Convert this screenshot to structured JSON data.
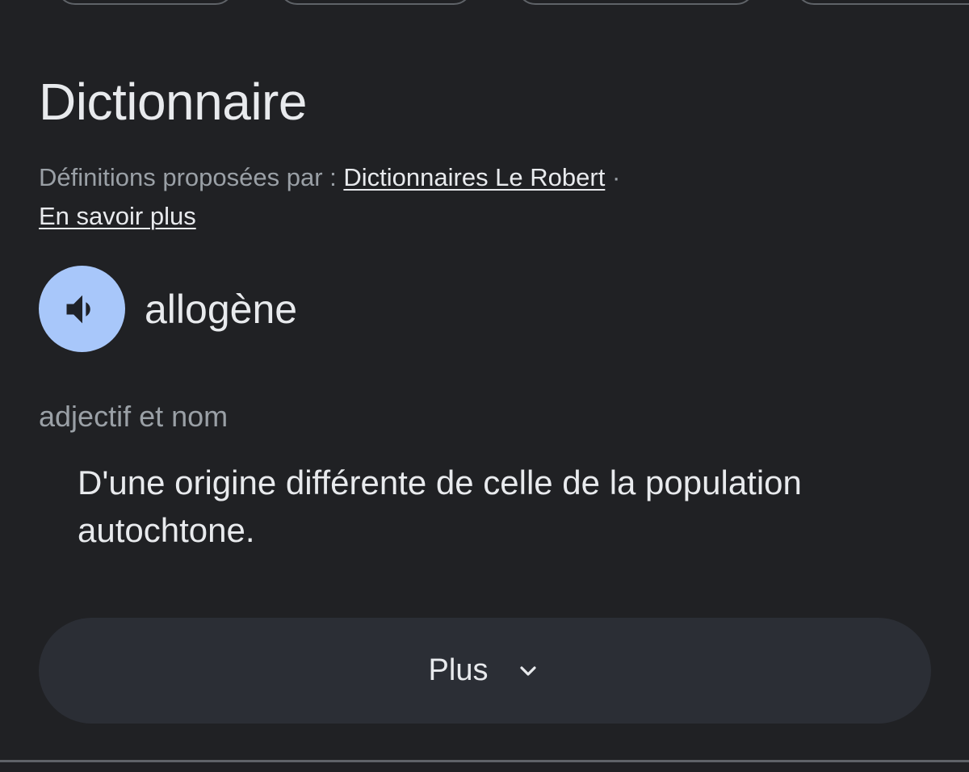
{
  "section": {
    "title": "Dictionnaire",
    "source_prefix": "Définitions proposées par : ",
    "source_link": "Dictionnaires Le Robert",
    "separator": " ·",
    "learn_more": "En savoir plus"
  },
  "entry": {
    "audio_icon": "volume-up-icon",
    "headword": "allogène",
    "part_of_speech": "adjectif et nom",
    "definition": "D'une origine différente de celle de la population autochtone."
  },
  "more_button": {
    "label": "Plus",
    "icon": "chevron-down-icon"
  },
  "colors": {
    "background": "#202124",
    "audio_button": "#a8c7fa",
    "more_button_bg": "#2b2e35",
    "muted_text": "#9aa0a6"
  }
}
